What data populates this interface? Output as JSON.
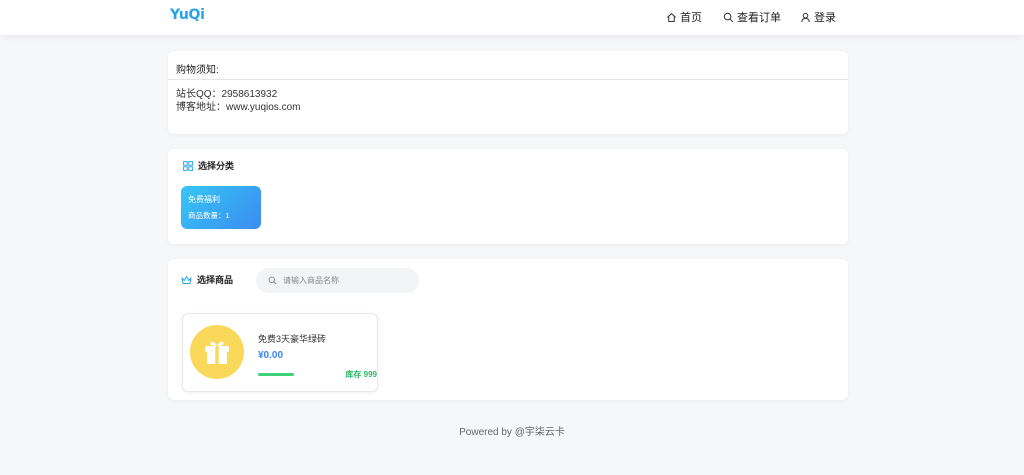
{
  "header": {
    "logo": "YuQi",
    "nav": [
      {
        "label": "首页",
        "icon": "home-icon"
      },
      {
        "label": "查看订单",
        "icon": "search-icon"
      },
      {
        "label": "登录",
        "icon": "user-icon"
      }
    ]
  },
  "notice": {
    "title": "购物须知:",
    "lines": [
      "站长QQ：2958613932",
      "博客地址：www.yuqios.com"
    ]
  },
  "category": {
    "heading": "选择分类",
    "icon": "grid-icon",
    "items": [
      {
        "name": "免费福利",
        "count_label": "商品数量：1"
      }
    ]
  },
  "goods": {
    "heading": "选择商品",
    "icon": "crown-icon",
    "search_placeholder": "请输入商品名称",
    "items": [
      {
        "name": "免费3天豪华绿砖",
        "price": "¥0.00",
        "stock": "库存 999",
        "stock_fraction": 1,
        "icon": "gift-icon"
      }
    ]
  },
  "footer": {
    "text": "Powered by @宇柒云卡"
  },
  "colors": {
    "accent": "#27a3e8",
    "tile_gradient_start": "#37c6f6",
    "tile_gradient_end": "#3a8cf0",
    "price": "#3b86f0",
    "stock": "#2eb868",
    "product_bg": "#f9d85a"
  }
}
